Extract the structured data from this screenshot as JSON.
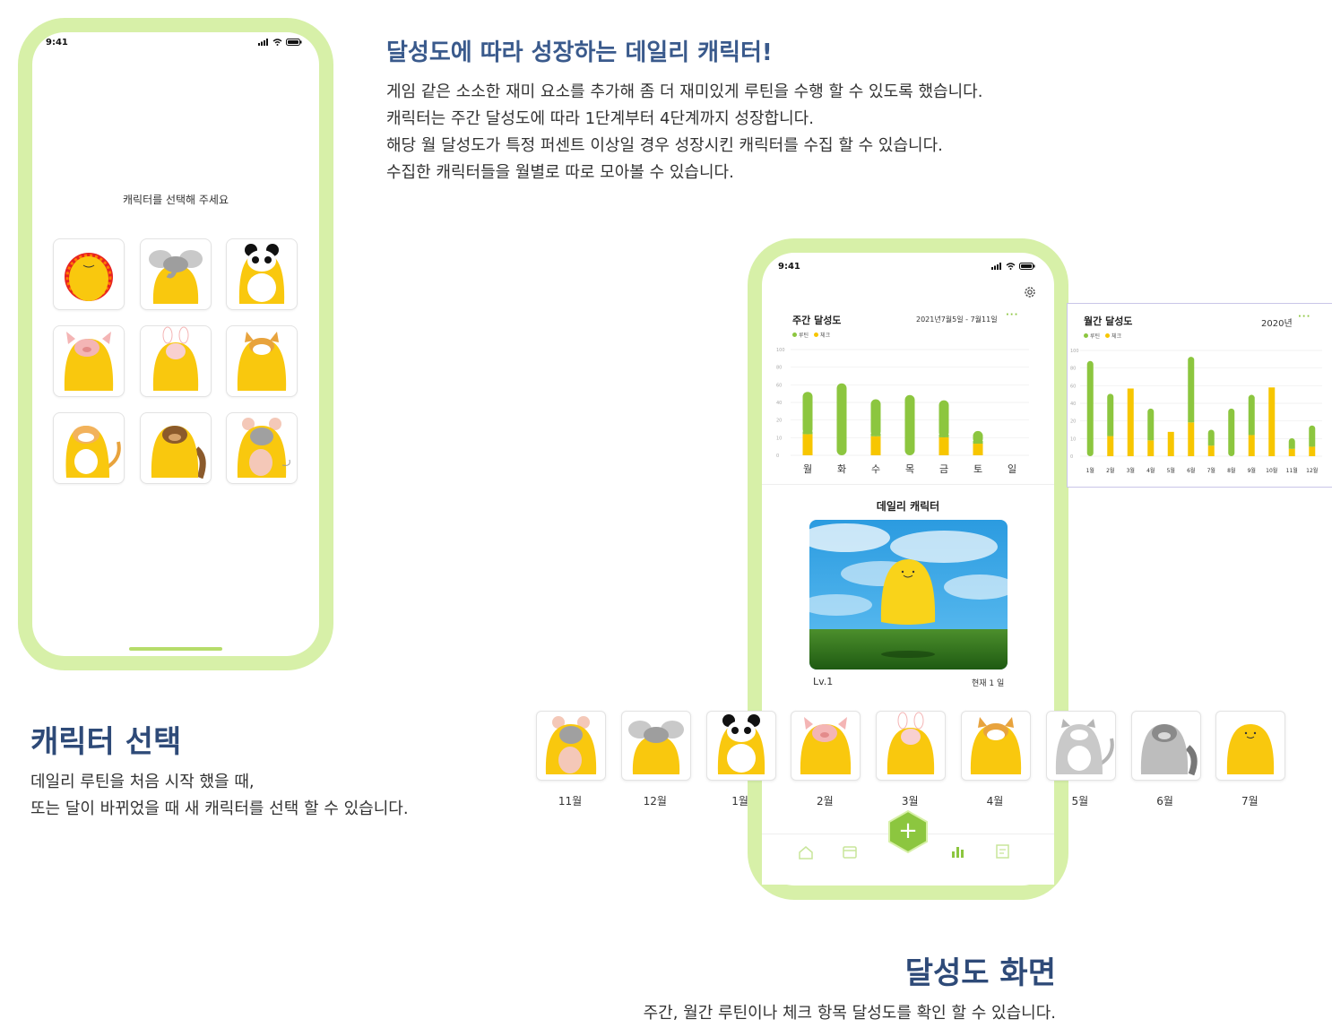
{
  "intro": {
    "title": "달성도에 따라 성장하는 데일리 캐릭터!",
    "lines": [
      "게임 같은 소소한 재미 요소를 추가해 좀 더 재미있게 루틴을 수행 할 수 있도록 했습니다.",
      "캐릭터는 주간 달성도에 따라 1단계부터 4단계까지 성장합니다.",
      "해당 월 달성도가 특정 퍼센트 이상일 경우 성장시킨 캐릭터를 수집 할 수 있습니다.",
      "수집한 캐릭터들을 월별로 따로 모아볼 수 있습니다."
    ]
  },
  "select_section": {
    "title": "캐릭터 선택",
    "lines": [
      "데일리 루틴을 처음 시작 했을 때,",
      "또는 달이 바뀌었을 때 새 캐릭터를 선택 할 수 있습니다."
    ]
  },
  "achieve_section": {
    "title": "달성도 화면",
    "line": "주간, 월간 루틴이나 체크 항목 달성도를 확인 할 수 있습니다."
  },
  "phone_left": {
    "time": "9:41",
    "prompt": "캐릭터를 선택해 주세요",
    "characters": [
      "lion",
      "elephant",
      "panda",
      "pig",
      "rabbit",
      "shiba",
      "cat",
      "raccoon",
      "mouse"
    ]
  },
  "phone_right": {
    "time": "9:41",
    "settings_icon": "gear-icon",
    "daily_character_title": "데일리 캐릭터",
    "level": "Lv.1",
    "current_day": "현재 1 일"
  },
  "legend": {
    "routine": "루틴",
    "check": "체크"
  },
  "colors": {
    "routine": "#8cc63f",
    "check": "#f7c600",
    "accent": "#d7f0a8",
    "plus": "#8cc63f"
  },
  "chart_data": [
    {
      "type": "bar",
      "title": "주간 달성도",
      "range_label": "2021년7월5일 - 7월11일",
      "categories": [
        "월",
        "화",
        "수",
        "목",
        "금",
        "토",
        "일"
      ],
      "yticks": [
        "100",
        "80",
        "60",
        "40",
        "20",
        "10",
        "0"
      ],
      "series": [
        {
          "name": "루틴",
          "values": [
            40,
            68,
            35,
            57,
            35,
            12,
            0
          ]
        },
        {
          "name": "체크",
          "values": [
            20,
            0,
            18,
            0,
            17,
            11,
            0
          ]
        }
      ],
      "stacked": true,
      "ylim": [
        0,
        100
      ],
      "legend": "top-left",
      "grid": true
    },
    {
      "type": "bar",
      "title": "월간 달성도",
      "range_label": "2020년",
      "categories": [
        "1월",
        "2월",
        "3월",
        "4월",
        "5월",
        "6월",
        "7월",
        "8월",
        "9월",
        "10월",
        "11월",
        "12월"
      ],
      "yticks": [
        "100",
        "80",
        "60",
        "40",
        "20",
        "10",
        "0"
      ],
      "series": [
        {
          "name": "루틴",
          "values": [
            90,
            40,
            0,
            30,
            0,
            62,
            15,
            45,
            38,
            0,
            10,
            20
          ]
        },
        {
          "name": "체크",
          "values": [
            0,
            19,
            64,
            15,
            23,
            32,
            10,
            0,
            20,
            65,
            7,
            9
          ]
        }
      ],
      "stacked": true,
      "ylim": [
        0,
        100
      ],
      "legend": "top-left",
      "grid": true
    }
  ],
  "collection": [
    {
      "month": "11월",
      "character": "mouse"
    },
    {
      "month": "12월",
      "character": "elephant"
    },
    {
      "month": "1월",
      "character": "panda"
    },
    {
      "month": "2월",
      "character": "pig"
    },
    {
      "month": "3월",
      "character": "rabbit"
    },
    {
      "month": "4월",
      "character": "shiba"
    },
    {
      "month": "5월",
      "character": "cat-grey"
    },
    {
      "month": "6월",
      "character": "raccoon-grey"
    },
    {
      "month": "7월",
      "character": "plain"
    }
  ],
  "tabbar": {
    "items": [
      "home-icon",
      "calendar-icon",
      "add-button",
      "stats-icon",
      "memo-icon"
    ],
    "plus_label": "+"
  }
}
